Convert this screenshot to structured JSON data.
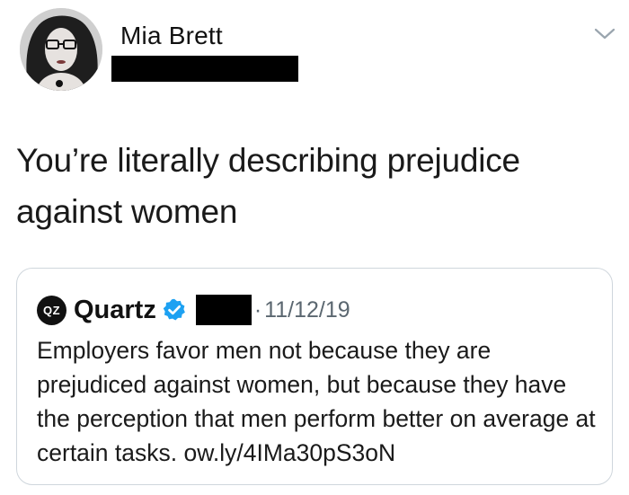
{
  "author": {
    "name": "Mia Brett",
    "handle_redacted": true
  },
  "menu": {
    "icon": "chevron-down-icon"
  },
  "tweet": {
    "text": "You’re literally describing prejudice against women"
  },
  "quote": {
    "logo_text": "QZ",
    "name": "Quartz",
    "verified": true,
    "separator": "·",
    "date": "11/12/19",
    "text": "Employers favor men not because they are prejudiced against women, but because they have the perception that men perform better on average at certain tasks. ow.ly/4IMa30pS3oN"
  },
  "colors": {
    "verified_badge": "#1da1f2",
    "card_border": "#cfd6dc",
    "secondary_text": "#5b6770"
  }
}
